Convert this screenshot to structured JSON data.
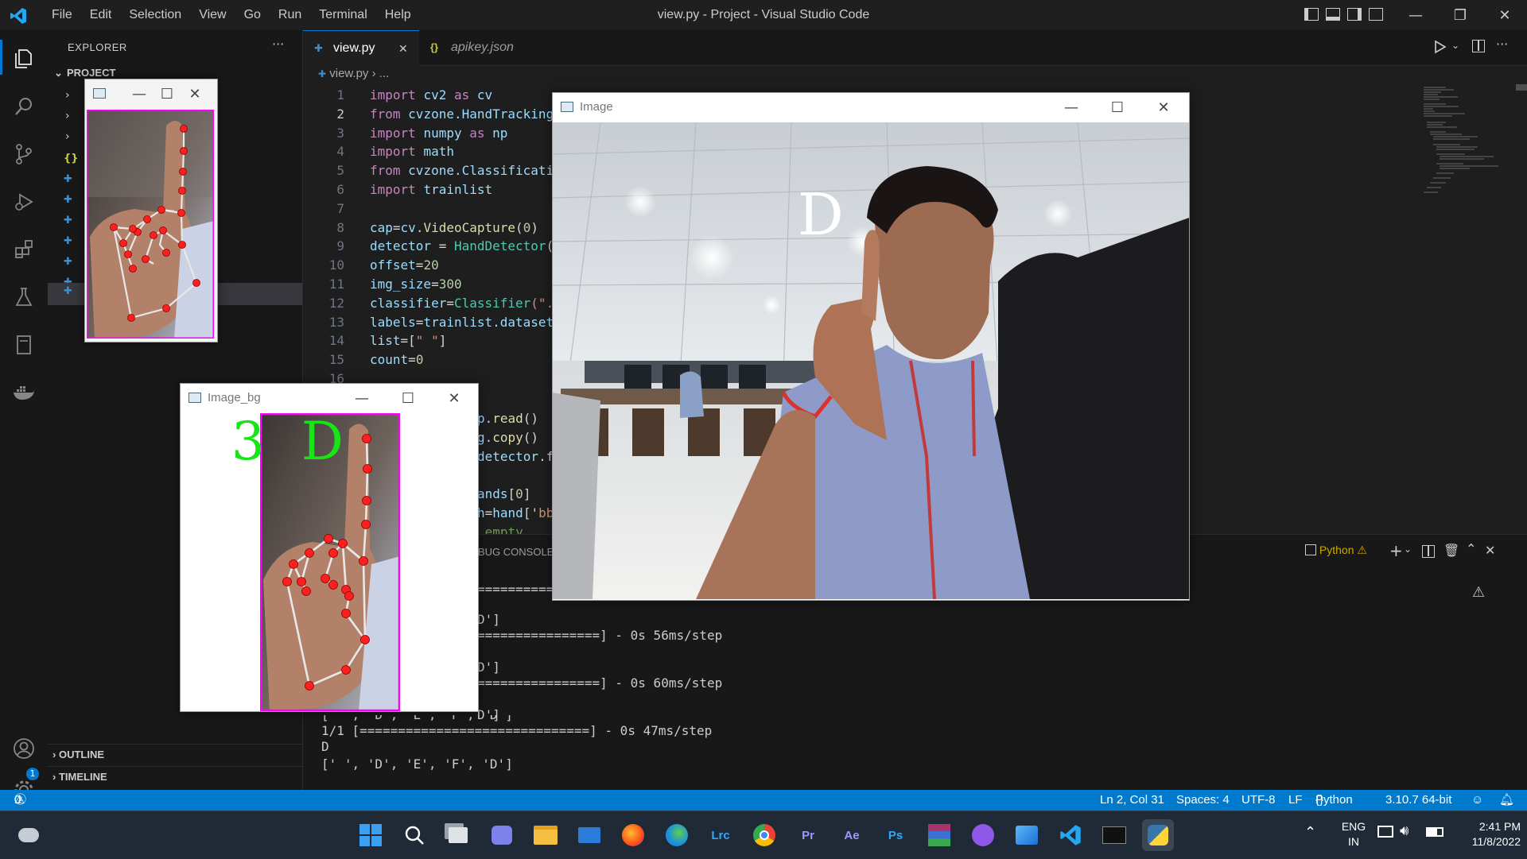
{
  "titlebar": {
    "menu": [
      "File",
      "Edit",
      "Selection",
      "View",
      "Go",
      "Run",
      "Terminal",
      "Help"
    ],
    "title": "view.py - Project - Visual Studio Code"
  },
  "sidebar": {
    "header": "EXPLORER",
    "more": "···",
    "project_label": "PROJECT",
    "outline": "OUTLINE",
    "timeline": "TIMELINE",
    "settings_badge": "1"
  },
  "tabs": [
    {
      "label": "view.py",
      "active": true,
      "close": "✕"
    },
    {
      "label": "apikey.json",
      "active": false
    }
  ],
  "breadcrumb": {
    "file": "view.py",
    "rest": "..."
  },
  "editor": {
    "line_numbers": [
      "1",
      "2",
      "3",
      "4",
      "5",
      "6",
      "7",
      "8",
      "9",
      "10",
      "11",
      "12",
      "13",
      "14",
      "15",
      "16"
    ],
    "lines": [
      [
        {
          "t": "import ",
          "c": "kw"
        },
        {
          "t": "cv2 ",
          "c": "var"
        },
        {
          "t": "as ",
          "c": "kw"
        },
        {
          "t": "cv",
          "c": "var"
        }
      ],
      [
        {
          "t": "from ",
          "c": "kw"
        },
        {
          "t": "cvzone.HandTracking",
          "c": "var"
        }
      ],
      [
        {
          "t": "import ",
          "c": "kw"
        },
        {
          "t": "numpy ",
          "c": "var"
        },
        {
          "t": "as ",
          "c": "kw"
        },
        {
          "t": "np",
          "c": "var"
        }
      ],
      [
        {
          "t": "import ",
          "c": "kw"
        },
        {
          "t": "math",
          "c": "var"
        }
      ],
      [
        {
          "t": "from ",
          "c": "kw"
        },
        {
          "t": "cvzone.Classificati",
          "c": "var"
        }
      ],
      [
        {
          "t": "import ",
          "c": "kw"
        },
        {
          "t": "trainlist",
          "c": "var"
        }
      ],
      [],
      [
        {
          "t": "cap",
          "c": "var"
        },
        {
          "t": "=",
          "c": ""
        },
        {
          "t": "cv",
          "c": "var"
        },
        {
          "t": ".",
          "c": ""
        },
        {
          "t": "VideoCapture",
          "c": "fn"
        },
        {
          "t": "(",
          "c": ""
        },
        {
          "t": "0",
          "c": "num"
        },
        {
          "t": ")",
          "c": ""
        }
      ],
      [
        {
          "t": "detector ",
          "c": "var"
        },
        {
          "t": "= ",
          "c": ""
        },
        {
          "t": "HandDetector",
          "c": "cls"
        },
        {
          "t": "(",
          "c": ""
        }
      ],
      [
        {
          "t": "offset",
          "c": "var"
        },
        {
          "t": "=",
          "c": ""
        },
        {
          "t": "20",
          "c": "num"
        }
      ],
      [
        {
          "t": "img_size",
          "c": "var"
        },
        {
          "t": "=",
          "c": ""
        },
        {
          "t": "300",
          "c": "num"
        }
      ],
      [
        {
          "t": "classifier",
          "c": "var"
        },
        {
          "t": "=",
          "c": ""
        },
        {
          "t": "Classifier",
          "c": "cls"
        },
        {
          "t": "(\".",
          "c": "str"
        }
      ],
      [
        {
          "t": "labels",
          "c": "var"
        },
        {
          "t": "=",
          "c": ""
        },
        {
          "t": "trainlist.dataset",
          "c": "var"
        }
      ],
      [
        {
          "t": "list",
          "c": "var"
        },
        {
          "t": "=[",
          "c": ""
        },
        {
          "t": "\" \"",
          "c": "str"
        },
        {
          "t": "]",
          "c": ""
        }
      ],
      [
        {
          "t": "count",
          "c": "var"
        },
        {
          "t": "=",
          "c": ""
        },
        {
          "t": "0",
          "c": "num"
        }
      ],
      []
    ],
    "partial_lines": [
      [
        {
          "t": "p.",
          "c": "var"
        },
        {
          "t": "read",
          "c": "fn"
        },
        {
          "t": "()",
          "c": ""
        }
      ],
      [
        {
          "t": "g.",
          "c": "var"
        },
        {
          "t": "copy",
          "c": "fn"
        },
        {
          "t": "()",
          "c": ""
        }
      ],
      [
        {
          "t": "detector",
          "c": "var"
        },
        {
          "t": ".f",
          "c": ""
        }
      ],
      [],
      [
        {
          "t": "ands",
          "c": "var"
        },
        {
          "t": "[",
          "c": ""
        },
        {
          "t": "0",
          "c": "num"
        },
        {
          "t": "]",
          "c": ""
        }
      ],
      [
        {
          "t": "h",
          "c": "var"
        },
        {
          "t": "=",
          "c": ""
        },
        {
          "t": "hand",
          "c": "var"
        },
        {
          "t": "['",
          "c": ""
        },
        {
          "t": "bb",
          "c": "str"
        }
      ],
      [
        {
          "t": " empty",
          "c": "cmt"
        }
      ]
    ]
  },
  "panel": {
    "tab_debug": "BUG CONSOLE",
    "terminal_name": "Python",
    "lines": [
      "================",
      "D']",
      "================] - 0s 56ms/step",
      "",
      "D']",
      "================] - 0s 60ms/step",
      "",
      "D']",
      "1/1 [==============================] - 0s 47ms/step",
      "D",
      "[' ', 'D', 'E', 'F', 'D']"
    ],
    "partial_label_line": "[' ', 'D', 'E', 'F', 'D']"
  },
  "status": {
    "errors": "0",
    "warnings": "0",
    "position": "Ln 2, Col 31",
    "spaces": "Spaces: 4",
    "encoding": "UTF-8",
    "eol": "LF",
    "language": "Python",
    "interpreter": "3.10.7 64-bit"
  },
  "windows": {
    "crop": {
      "title": ""
    },
    "image_bg": {
      "title": "Image_bg",
      "count_text": "3",
      "letter_text": "D"
    },
    "image": {
      "title": "Image",
      "letter_text": "D"
    }
  },
  "taskbar": {
    "apps": [
      "Lrc",
      "Pr",
      "Ae",
      "Ps"
    ],
    "lang_top": "ENG",
    "lang_bottom": "IN",
    "time": "2:41 PM",
    "date": "11/8/2022"
  },
  "colors": {
    "accent": "#007acc",
    "landmark": "#ff1f1f",
    "green_text": "#16e616",
    "magenta_box": "#ff00ff"
  }
}
